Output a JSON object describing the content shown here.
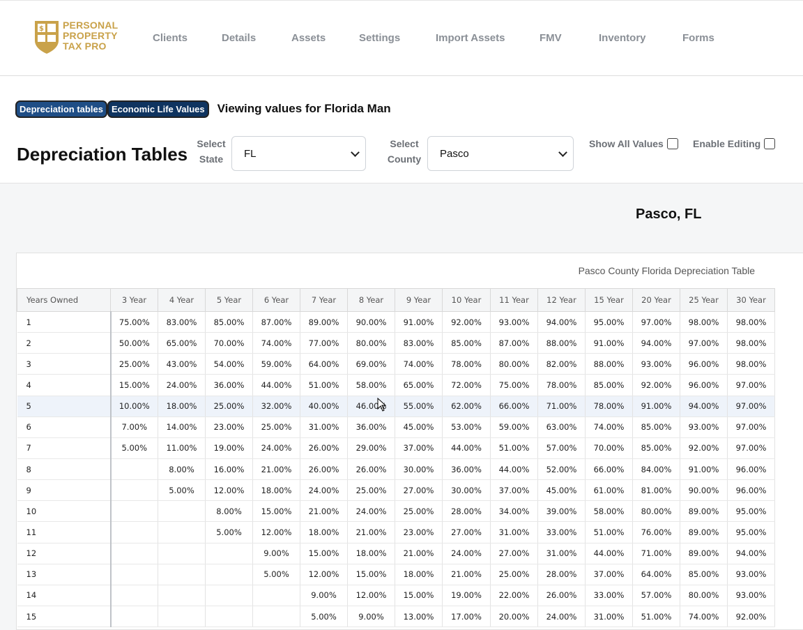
{
  "brand": {
    "logo_lines": [
      "PERSONAL",
      "PROPERTY",
      "TAX PRO"
    ],
    "logo_color": "#c9a24a"
  },
  "nav": [
    "Clients",
    "Details",
    "Assets",
    "Settings",
    "Import Assets",
    "FMV",
    "Inventory",
    "Forms"
  ],
  "tabs": {
    "depreciation": "Depreciation tables",
    "economic_life": "Economic Life Values",
    "viewing": "Viewing values for Florida Man"
  },
  "page_title": "Depreciation Tables",
  "state_select": {
    "label_line1": "Select",
    "label_line2": "State",
    "value": "FL"
  },
  "county_select": {
    "label_line1": "Select",
    "label_line2": "County",
    "value": "Pasco"
  },
  "show_all_values": "Show All Values",
  "enable_editing": "Enable Editing",
  "county_title": "Pasco, FL",
  "table_caption": "Pasco County Florida Depreciation Table",
  "table": {
    "headers": [
      "Years Owned",
      "3 Year",
      "4 Year",
      "5 Year",
      "6 Year",
      "7 Year",
      "8 Year",
      "9 Year",
      "10 Year",
      "11 Year",
      "12 Year",
      "15 Year",
      "20 Year",
      "25 Year",
      "30 Year"
    ],
    "rows": [
      [
        "1",
        "75.00%",
        "83.00%",
        "85.00%",
        "87.00%",
        "89.00%",
        "90.00%",
        "91.00%",
        "92.00%",
        "93.00%",
        "94.00%",
        "95.00%",
        "97.00%",
        "98.00%",
        "98.00%"
      ],
      [
        "2",
        "50.00%",
        "65.00%",
        "70.00%",
        "74.00%",
        "77.00%",
        "80.00%",
        "83.00%",
        "85.00%",
        "87.00%",
        "88.00%",
        "91.00%",
        "94.00%",
        "97.00%",
        "98.00%"
      ],
      [
        "3",
        "25.00%",
        "43.00%",
        "54.00%",
        "59.00%",
        "64.00%",
        "69.00%",
        "74.00%",
        "78.00%",
        "80.00%",
        "82.00%",
        "88.00%",
        "93.00%",
        "96.00%",
        "98.00%"
      ],
      [
        "4",
        "15.00%",
        "24.00%",
        "36.00%",
        "44.00%",
        "51.00%",
        "58.00%",
        "65.00%",
        "72.00%",
        "75.00%",
        "78.00%",
        "85.00%",
        "92.00%",
        "96.00%",
        "97.00%"
      ],
      [
        "5",
        "10.00%",
        "18.00%",
        "25.00%",
        "32.00%",
        "40.00%",
        "46.00%",
        "55.00%",
        "62.00%",
        "66.00%",
        "71.00%",
        "78.00%",
        "91.00%",
        "94.00%",
        "97.00%"
      ],
      [
        "6",
        "7.00%",
        "14.00%",
        "23.00%",
        "25.00%",
        "31.00%",
        "36.00%",
        "45.00%",
        "53.00%",
        "59.00%",
        "63.00%",
        "74.00%",
        "85.00%",
        "93.00%",
        "97.00%"
      ],
      [
        "7",
        "5.00%",
        "11.00%",
        "19.00%",
        "24.00%",
        "26.00%",
        "29.00%",
        "37.00%",
        "44.00%",
        "51.00%",
        "57.00%",
        "70.00%",
        "85.00%",
        "92.00%",
        "97.00%"
      ],
      [
        "8",
        "",
        "8.00%",
        "16.00%",
        "21.00%",
        "26.00%",
        "26.00%",
        "30.00%",
        "36.00%",
        "44.00%",
        "52.00%",
        "66.00%",
        "84.00%",
        "91.00%",
        "96.00%"
      ],
      [
        "9",
        "",
        "5.00%",
        "12.00%",
        "18.00%",
        "24.00%",
        "25.00%",
        "27.00%",
        "30.00%",
        "37.00%",
        "45.00%",
        "61.00%",
        "81.00%",
        "90.00%",
        "96.00%"
      ],
      [
        "10",
        "",
        "",
        "8.00%",
        "15.00%",
        "21.00%",
        "24.00%",
        "25.00%",
        "28.00%",
        "34.00%",
        "39.00%",
        "58.00%",
        "80.00%",
        "89.00%",
        "95.00%"
      ],
      [
        "11",
        "",
        "",
        "5.00%",
        "12.00%",
        "18.00%",
        "21.00%",
        "23.00%",
        "27.00%",
        "31.00%",
        "33.00%",
        "51.00%",
        "76.00%",
        "89.00%",
        "95.00%"
      ],
      [
        "12",
        "",
        "",
        "",
        "9.00%",
        "15.00%",
        "18.00%",
        "21.00%",
        "24.00%",
        "27.00%",
        "31.00%",
        "44.00%",
        "71.00%",
        "89.00%",
        "94.00%"
      ],
      [
        "13",
        "",
        "",
        "",
        "5.00%",
        "12.00%",
        "15.00%",
        "18.00%",
        "21.00%",
        "25.00%",
        "28.00%",
        "37.00%",
        "64.00%",
        "85.00%",
        "93.00%"
      ],
      [
        "14",
        "",
        "",
        "",
        "",
        "9.00%",
        "12.00%",
        "15.00%",
        "19.00%",
        "22.00%",
        "26.00%",
        "33.00%",
        "57.00%",
        "80.00%",
        "93.00%"
      ],
      [
        "15",
        "",
        "",
        "",
        "",
        "5.00%",
        "9.00%",
        "13.00%",
        "17.00%",
        "20.00%",
        "24.00%",
        "31.00%",
        "51.00%",
        "74.00%",
        "92.00%"
      ]
    ],
    "highlighted_row_index": 4
  }
}
